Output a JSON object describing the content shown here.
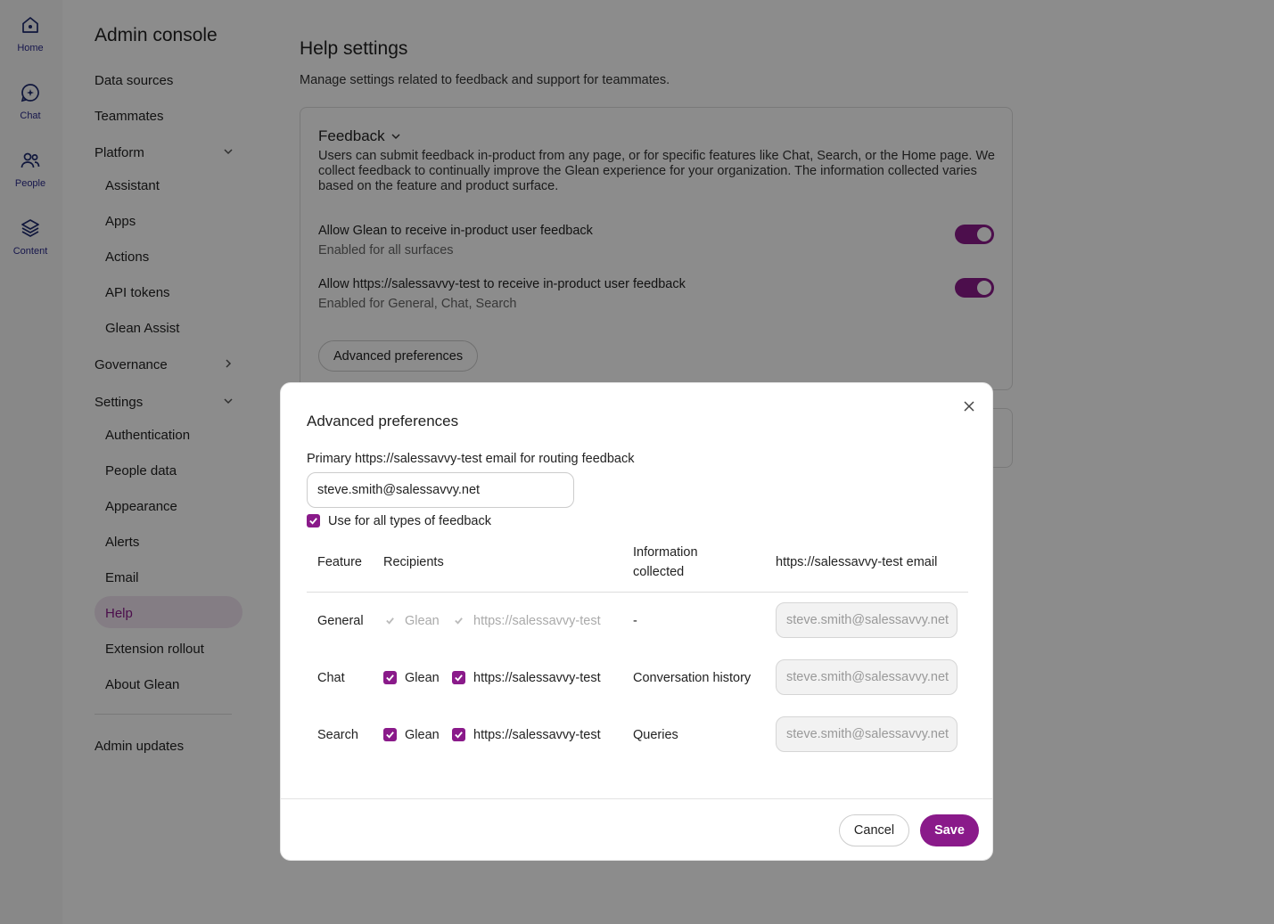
{
  "rail": {
    "items": [
      {
        "label": "Home",
        "icon": "home-icon"
      },
      {
        "label": "Chat",
        "icon": "chat-icon"
      },
      {
        "label": "People",
        "icon": "people-icon"
      },
      {
        "label": "Content",
        "icon": "layers-icon"
      }
    ]
  },
  "nav": {
    "title": "Admin console",
    "data_sources": "Data sources",
    "teammates": "Teammates",
    "platform": "Platform",
    "assistant": "Assistant",
    "apps": "Apps",
    "actions": "Actions",
    "api_tokens": "API tokens",
    "glean_assist": "Glean Assist",
    "governance": "Governance",
    "settings": "Settings",
    "authentication": "Authentication",
    "people_data": "People data",
    "appearance": "Appearance",
    "alerts": "Alerts",
    "email": "Email",
    "help": "Help",
    "extension_rollout": "Extension rollout",
    "about_glean": "About Glean",
    "admin_updates": "Admin updates"
  },
  "main": {
    "title": "Help settings",
    "description": "Manage settings related to feedback and support for teammates.",
    "feedback": {
      "heading": "Feedback",
      "description": "Users can submit feedback in-product from any page, or for specific features like Chat, Search, or the Home page. We collect feedback to continually improve the Glean experience for your organization. The information collected varies based on the feature and product surface.",
      "setting1_title": "Allow Glean to receive in-product user feedback",
      "setting1_sub": "Enabled for all surfaces",
      "setting1_enabled": true,
      "setting2_title": "Allow https://salessavvy-test to receive in-product user feedback",
      "setting2_sub": "Enabled for General, Chat, Search",
      "setting2_enabled": true,
      "advanced_button": "Advanced preferences"
    }
  },
  "modal": {
    "title": "Advanced preferences",
    "email_label": "Primary https://salessavvy-test email for routing feedback",
    "email_value": "steve.smith@salessavvy.net",
    "use_all_label": "Use for all types of feedback",
    "use_all_checked": true,
    "columns": {
      "feature": "Feature",
      "recipients": "Recipients",
      "info_line1": "Information",
      "info_line2": "collected",
      "email": "https://salessavvy-test email"
    },
    "rows": [
      {
        "feature": "General",
        "glean": "Glean",
        "org": "https://salessavvy-test",
        "info": "-",
        "email": "steve.smith@salessavvy.net",
        "disabled": true
      },
      {
        "feature": "Chat",
        "glean": "Glean",
        "org": "https://salessavvy-test",
        "info": "Conversation history",
        "email": "steve.smith@salessavvy.net",
        "disabled": false
      },
      {
        "feature": "Search",
        "glean": "Glean",
        "org": "https://salessavvy-test",
        "info": "Queries",
        "email": "steve.smith@salessavvy.net",
        "disabled": false
      }
    ],
    "cancel": "Cancel",
    "save": "Save"
  },
  "colors": {
    "accent": "#8a1a8a",
    "nav_active_bg": "#f0e3f0",
    "rail_icon": "#2a2a8a"
  }
}
